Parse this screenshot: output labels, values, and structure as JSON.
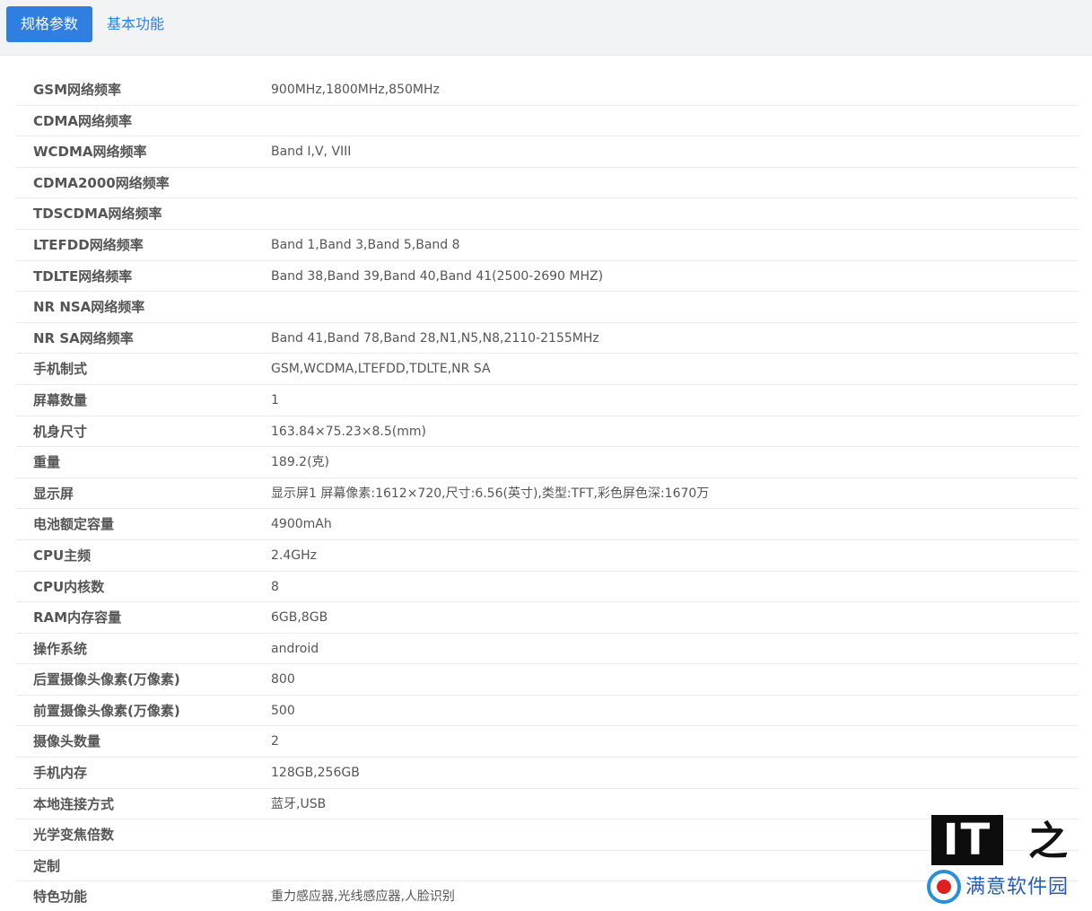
{
  "tabs": [
    {
      "label": "规格参数",
      "active": true
    },
    {
      "label": "基本功能",
      "active": false
    }
  ],
  "specs": [
    {
      "label": "GSM网络频率",
      "value": "900MHz,1800MHz,850MHz"
    },
    {
      "label": "CDMA网络频率",
      "value": ""
    },
    {
      "label": "WCDMA网络频率",
      "value": "Band Ⅰ,V, VIII"
    },
    {
      "label": "CDMA2000网络频率",
      "value": ""
    },
    {
      "label": "TDSCDMA网络频率",
      "value": ""
    },
    {
      "label": "LTEFDD网络频率",
      "value": "Band 1,Band 3,Band 5,Band 8"
    },
    {
      "label": "TDLTE网络频率",
      "value": "Band 38,Band 39,Band 40,Band 41(2500-2690 MHZ)"
    },
    {
      "label": "NR NSA网络频率",
      "value": ""
    },
    {
      "label": "NR SA网络频率",
      "value": "Band 41,Band 78,Band 28,N1,N5,N8,2110-2155MHz"
    },
    {
      "label": "手机制式",
      "value": "GSM,WCDMA,LTEFDD,TDLTE,NR SA"
    },
    {
      "label": "屏幕数量",
      "value": "1"
    },
    {
      "label": "机身尺寸",
      "value": "163.84×75.23×8.5(mm)"
    },
    {
      "label": "重量",
      "value": "189.2(克)"
    },
    {
      "label": "显示屏",
      "value": "显示屏1 屏幕像素:1612×720,尺寸:6.56(英寸),类型:TFT,彩色屏色深:1670万"
    },
    {
      "label": "电池额定容量",
      "value": "4900mAh"
    },
    {
      "label": "CPU主频",
      "value": "2.4GHz"
    },
    {
      "label": "CPU内核数",
      "value": "8"
    },
    {
      "label": "RAM内存容量",
      "value": "6GB,8GB"
    },
    {
      "label": "操作系统",
      "value": "android"
    },
    {
      "label": "后置摄像头像素(万像素)",
      "value": "800"
    },
    {
      "label": "前置摄像头像素(万像素)",
      "value": "500"
    },
    {
      "label": "摄像头数量",
      "value": "2"
    },
    {
      "label": "手机内存",
      "value": "128GB,256GB"
    },
    {
      "label": "本地连接方式",
      "value": "蓝牙,USB"
    },
    {
      "label": "光学变焦倍数",
      "value": ""
    },
    {
      "label": "定制",
      "value": ""
    },
    {
      "label": "特色功能",
      "value": "重力感应器,光线感应器,人脸识别"
    }
  ],
  "watermark": {
    "logo_letters": "IT",
    "logo_glyph": "之家",
    "caption": "满意软件园"
  },
  "colors": {
    "accent": "#2f7ee0",
    "tabbar_bg": "#f2f3f5",
    "row_border": "#e9e9ec"
  }
}
